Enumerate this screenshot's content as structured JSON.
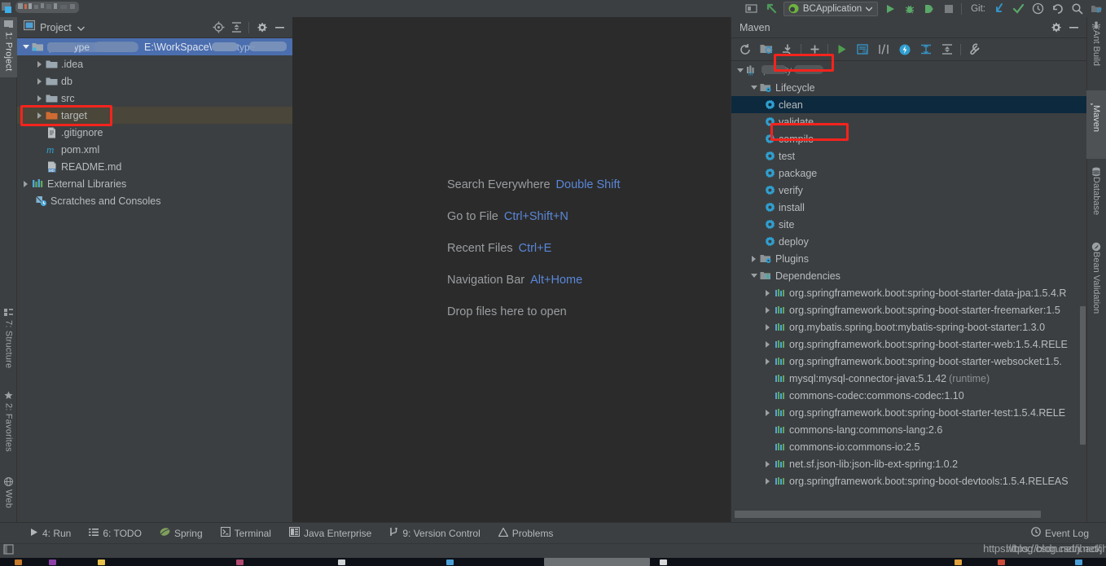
{
  "window": {
    "title_redacted": true
  },
  "toolbar": {
    "run_config": "BCApplication",
    "git_label": "Git:",
    "icons": [
      "toggle-tool-window-icon",
      "undo-arrow-icon",
      "run-icon",
      "debug-icon",
      "run-with-coverage-icon",
      "stop-icon",
      "update-project-icon",
      "commit-icon",
      "history-icon",
      "rollback-icon",
      "search-icon",
      "project-structure-icon"
    ]
  },
  "left_rail": {
    "tabs": [
      {
        "label": "1: Project",
        "icon": "project-icon",
        "active": true
      },
      {
        "label": "7: Structure",
        "icon": "structure-icon",
        "active": false
      },
      {
        "label": "2: Favorites",
        "icon": "star-icon",
        "active": false
      },
      {
        "label": "Web",
        "icon": "web-icon",
        "active": false
      }
    ]
  },
  "right_rail": {
    "tabs": [
      {
        "label": "Ant Build",
        "icon": "ant-icon",
        "active": false
      },
      {
        "label": "Maven",
        "icon": "maven-m-icon",
        "active": true
      },
      {
        "label": "Database",
        "icon": "database-icon",
        "active": false
      },
      {
        "label": "Bean Validation",
        "icon": "bean-validation-icon",
        "active": false
      }
    ]
  },
  "project_panel": {
    "title": "Project",
    "title_dropdown": "chevron-down-icon",
    "header_icons": [
      "locate-icon",
      "collapse-all-icon",
      "gear-icon",
      "hide-icon"
    ],
    "tree": [
      {
        "depth": 0,
        "arrow": "down",
        "icon": "module-icon",
        "label": "",
        "label_redacted": true,
        "path": "E:\\WorkSpace\\",
        "path_redacted_tail": true,
        "selected": "blue"
      },
      {
        "depth": 1,
        "arrow": "right",
        "icon": "folder-icon",
        "label": ".idea"
      },
      {
        "depth": 1,
        "arrow": "right",
        "icon": "folder-icon",
        "label": "db"
      },
      {
        "depth": 1,
        "arrow": "right",
        "icon": "folder-icon",
        "label": "src"
      },
      {
        "depth": 1,
        "arrow": "right",
        "icon": "folder-orange-icon",
        "label": "target",
        "selected": "olive",
        "highlighted": true
      },
      {
        "depth": 1,
        "arrow": "none",
        "icon": "gitignore-file-icon",
        "label": ".gitignore"
      },
      {
        "depth": 1,
        "arrow": "none",
        "icon": "maven-pom-icon",
        "label": "pom.xml"
      },
      {
        "depth": 1,
        "arrow": "none",
        "icon": "markdown-file-icon",
        "label": "README.md"
      },
      {
        "depth": 0,
        "arrow": "right",
        "icon": "library-icon",
        "label": "External Libraries"
      },
      {
        "depth": 0,
        "arrow": "none",
        "icon": "scratches-icon",
        "label": "Scratches and Consoles"
      }
    ]
  },
  "editor": {
    "hints": [
      {
        "action": "Search Everywhere",
        "shortcut": "Double Shift"
      },
      {
        "action": "Go to File",
        "shortcut": "Ctrl+Shift+N"
      },
      {
        "action": "Recent Files",
        "shortcut": "Ctrl+E"
      },
      {
        "action": "Navigation Bar",
        "shortcut": "Alt+Home"
      },
      {
        "action": "Drop files here to open",
        "shortcut": ""
      }
    ]
  },
  "maven_panel": {
    "title": "Maven",
    "header_icons": [
      "gear-icon",
      "hide-icon"
    ],
    "toolbar_icons": [
      "reimport-icon",
      "generate-sources-icon",
      "download-sources-icon",
      "add-icon",
      "run-icon",
      "execute-maven-goal-icon",
      "toggle-skip-tests-icon",
      "offline-mode-icon",
      "show-dependencies-icon",
      "collapse-all-icon",
      "settings-wrench-icon"
    ],
    "tree": [
      {
        "depth": 0,
        "arrow": "down",
        "icon": "maven-project-icon",
        "label": "",
        "label_redacted": true
      },
      {
        "depth": 1,
        "arrow": "down",
        "icon": "lifecycle-folder-icon",
        "label": "Lifecycle"
      },
      {
        "depth": 2,
        "arrow": "none",
        "icon": "goal-gear-icon",
        "label": "clean",
        "selected": "dark",
        "highlighted": true
      },
      {
        "depth": 2,
        "arrow": "none",
        "icon": "goal-gear-icon",
        "label": "validate"
      },
      {
        "depth": 2,
        "arrow": "none",
        "icon": "goal-gear-icon",
        "label": "compile"
      },
      {
        "depth": 2,
        "arrow": "none",
        "icon": "goal-gear-icon",
        "label": "test"
      },
      {
        "depth": 2,
        "arrow": "none",
        "icon": "goal-gear-icon",
        "label": "package",
        "highlighted": true
      },
      {
        "depth": 2,
        "arrow": "none",
        "icon": "goal-gear-icon",
        "label": "verify"
      },
      {
        "depth": 2,
        "arrow": "none",
        "icon": "goal-gear-icon",
        "label": "install"
      },
      {
        "depth": 2,
        "arrow": "none",
        "icon": "goal-gear-icon",
        "label": "site"
      },
      {
        "depth": 2,
        "arrow": "none",
        "icon": "goal-gear-icon",
        "label": "deploy"
      },
      {
        "depth": 1,
        "arrow": "right",
        "icon": "plugins-folder-icon",
        "label": "Plugins"
      },
      {
        "depth": 1,
        "arrow": "down",
        "icon": "dependencies-folder-icon",
        "label": "Dependencies"
      },
      {
        "depth": 2,
        "arrow": "right",
        "icon": "dependency-icon",
        "label": "org.springframework.boot:spring-boot-starter-data-jpa:1.5.4.R"
      },
      {
        "depth": 2,
        "arrow": "right",
        "icon": "dependency-icon",
        "label": "org.springframework.boot:spring-boot-starter-freemarker:1.5"
      },
      {
        "depth": 2,
        "arrow": "right",
        "icon": "dependency-icon",
        "label": "org.mybatis.spring.boot:mybatis-spring-boot-starter:1.3.0"
      },
      {
        "depth": 2,
        "arrow": "right",
        "icon": "dependency-icon",
        "label": "org.springframework.boot:spring-boot-starter-web:1.5.4.RELE"
      },
      {
        "depth": 2,
        "arrow": "right",
        "icon": "dependency-icon",
        "label": "org.springframework.boot:spring-boot-starter-websocket:1.5."
      },
      {
        "depth": 2,
        "arrow": "none",
        "icon": "dependency-icon",
        "label": "mysql:mysql-connector-java:5.1.42",
        "suffix": "(runtime)"
      },
      {
        "depth": 2,
        "arrow": "none",
        "icon": "dependency-icon",
        "label": "commons-codec:commons-codec:1.10"
      },
      {
        "depth": 2,
        "arrow": "right",
        "icon": "dependency-icon",
        "label": "org.springframework.boot:spring-boot-starter-test:1.5.4.RELE"
      },
      {
        "depth": 2,
        "arrow": "none",
        "icon": "dependency-icon",
        "label": "commons-lang:commons-lang:2.6"
      },
      {
        "depth": 2,
        "arrow": "none",
        "icon": "dependency-icon",
        "label": "commons-io:commons-io:2.5"
      },
      {
        "depth": 2,
        "arrow": "right",
        "icon": "dependency-icon",
        "label": "net.sf.json-lib:json-lib-ext-spring:1.0.2"
      },
      {
        "depth": 2,
        "arrow": "right",
        "icon": "dependency-icon",
        "label": "org.springframework.boot:spring-boot-devtools:1.5.4.RELEAS"
      }
    ]
  },
  "statusbar": {
    "items": [
      {
        "label": "4: Run",
        "underline": "4",
        "icon": "run-triangle-icon"
      },
      {
        "label": "6: TODO",
        "underline": "6",
        "icon": "todo-list-icon"
      },
      {
        "label": "Spring",
        "underline": "",
        "icon": "spring-leaf-icon"
      },
      {
        "label": "Terminal",
        "underline": "",
        "icon": "terminal-icon"
      },
      {
        "label": "Java Enterprise",
        "underline": "",
        "icon": "java-enterprise-icon"
      },
      {
        "label": "9: Version Control",
        "underline": "9",
        "icon": "version-control-icon"
      },
      {
        "label": "Problems",
        "underline": "",
        "icon": "warning-triangle-icon"
      }
    ],
    "event_log": "Event Log",
    "event_log_icon": "event-log-icon"
  },
  "watermark": {
    "text_a": "https://blog.csdn.net/jhack",
    "text_b": "https://blog.csdn.net/jhack"
  },
  "colors": {
    "panel_bg": "#3c3f41",
    "editor_bg": "#2b2b2b",
    "selection_blue": "#4b6eaf",
    "selection_olive": "#4a4639",
    "selection_dark": "#0d293e",
    "annotation_red": "#f5231d",
    "accent_link": "#5a87d8",
    "text_primary": "#b9bcbe",
    "maven_icon_blue": "#389fd6",
    "run_green": "#59a869"
  }
}
